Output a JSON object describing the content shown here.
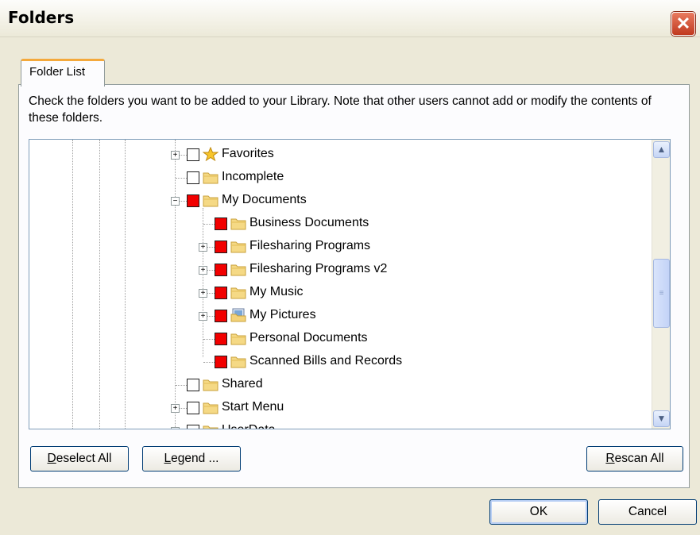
{
  "window": {
    "title": "Folders"
  },
  "tab": {
    "label": "Folder List"
  },
  "instructions": "Check the folders you want to be added to your Library. Note that other users cannot add or modify the contents of these folders.",
  "tree": {
    "items": [
      {
        "label": "Favorites",
        "checked": false,
        "icon": "star-folder-icon",
        "expander": "+"
      },
      {
        "label": "Incomplete",
        "checked": false,
        "icon": "folder-icon",
        "expander": ""
      },
      {
        "label": "My Documents",
        "checked": true,
        "icon": "folder-icon",
        "expander": "-"
      },
      {
        "label": "Business Documents",
        "checked": true,
        "icon": "folder-icon",
        "expander": ""
      },
      {
        "label": "Filesharing Programs",
        "checked": true,
        "icon": "folder-icon",
        "expander": "+"
      },
      {
        "label": "Filesharing Programs v2",
        "checked": true,
        "icon": "folder-icon",
        "expander": "+"
      },
      {
        "label": "My Music",
        "checked": true,
        "icon": "folder-icon",
        "expander": "+"
      },
      {
        "label": "My Pictures",
        "checked": true,
        "icon": "pictures-folder-icon",
        "expander": "+"
      },
      {
        "label": "Personal Documents",
        "checked": true,
        "icon": "folder-icon",
        "expander": ""
      },
      {
        "label": "Scanned Bills and Records",
        "checked": true,
        "icon": "folder-icon",
        "expander": ""
      },
      {
        "label": "Shared",
        "checked": false,
        "icon": "folder-icon",
        "expander": ""
      },
      {
        "label": "Start Menu",
        "checked": false,
        "icon": "folder-icon",
        "expander": "+"
      },
      {
        "label": "UserData",
        "checked": false,
        "icon": "folder-icon",
        "expander": "+"
      }
    ]
  },
  "buttons": {
    "deselect_all": "Deselect All",
    "legend": "Legend ...",
    "rescan_all": "Rescan All",
    "ok": "OK",
    "cancel": "Cancel"
  },
  "colors": {
    "checked_fill": "#f20000",
    "tab_accent": "#f4a93c",
    "close_button": "#c0391f"
  }
}
